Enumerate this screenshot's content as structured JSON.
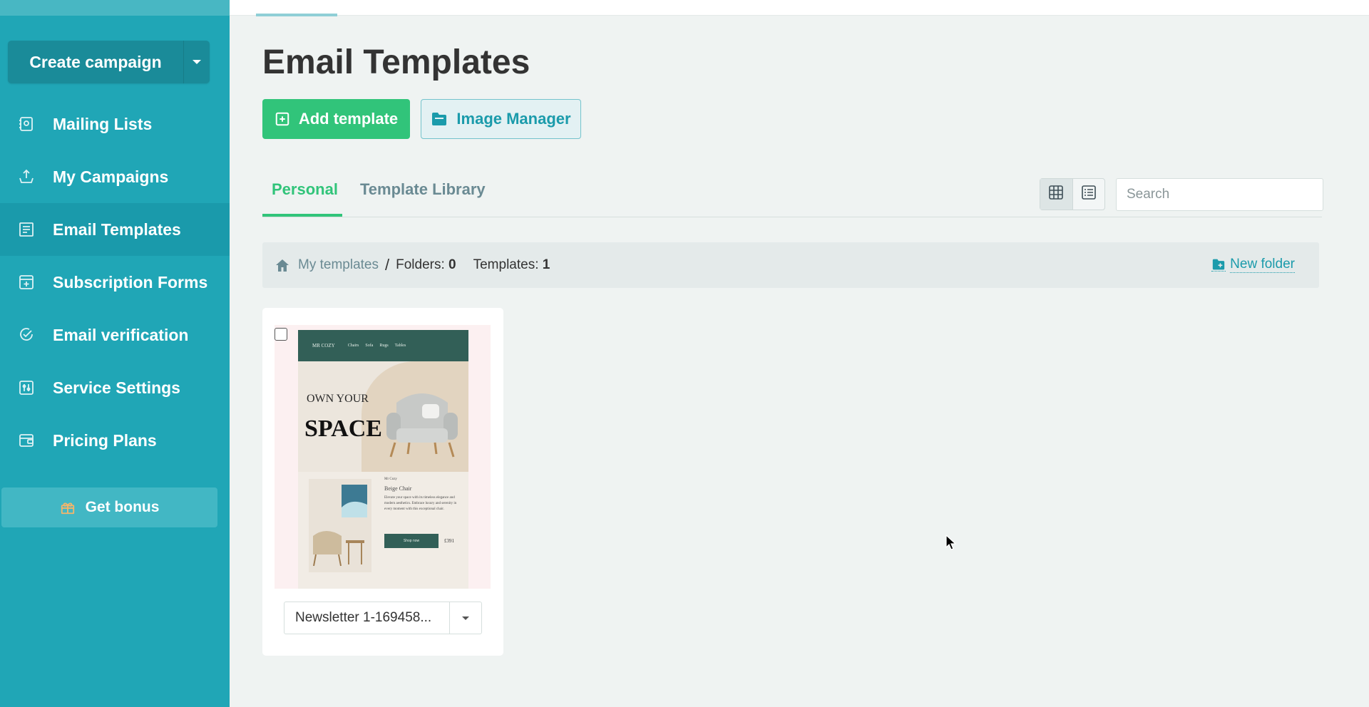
{
  "sidebar": {
    "create_campaign": "Create campaign",
    "items": [
      {
        "label": "Mailing Lists",
        "icon": "contacts-book-icon"
      },
      {
        "label": "My Campaigns",
        "icon": "upload-tray-icon"
      },
      {
        "label": "Email Templates",
        "icon": "template-icon",
        "active": true
      },
      {
        "label": "Subscription Forms",
        "icon": "form-plus-icon"
      },
      {
        "label": "Email verification",
        "icon": "check-circle-icon"
      },
      {
        "label": "Service Settings",
        "icon": "sliders-icon"
      },
      {
        "label": "Pricing Plans",
        "icon": "wallet-icon"
      }
    ],
    "bonus": "Get bonus",
    "bonus_icon": "gift-icon"
  },
  "main": {
    "title": "Email Templates",
    "add_template": "Add template",
    "image_manager": "Image Manager",
    "tabs": [
      {
        "label": "Personal",
        "active": true
      },
      {
        "label": "Template Library",
        "active": false
      }
    ],
    "view_mode": "grid",
    "search": {
      "placeholder": "Search",
      "value": ""
    },
    "breadcrumb": {
      "root": "My templates",
      "separator": "/",
      "folders_label": "Folders:",
      "folders_count": "0",
      "templates_label": "Templates:",
      "templates_count": "1",
      "new_folder": "New folder"
    },
    "templates": [
      {
        "name": "Newsletter 1-169458...",
        "checked": false,
        "preview": {
          "logo": "MR COZY",
          "nav": [
            "Chairs",
            "Sofa",
            "Rugs",
            "Tables"
          ],
          "headline_1": "OWN YOUR",
          "headline_2": "SPACE",
          "brand": "Mr Cozy",
          "product_name": "Beige Chair",
          "product_desc": "Elevate your space with its timeless elegance and modern aesthetics. Embrace luxury and serenity in every moment with this exceptional chair.",
          "shop_button": "Shop now",
          "price": "£391"
        }
      }
    ]
  },
  "colors": {
    "sidebar": "#20a6b6",
    "sidebar_active": "#1a9aab",
    "primary_green": "#31c47a",
    "teal_text": "#1b9bab",
    "page_bg": "#eff3f2"
  }
}
